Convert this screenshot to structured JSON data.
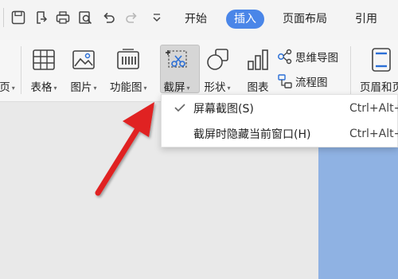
{
  "tabs": {
    "start": "开始",
    "insert": "插入",
    "layout": "页面布局",
    "reference": "引用"
  },
  "ribbon": {
    "cut_label": "页",
    "table_label": "表格",
    "picture_label": "图片",
    "function_label": "功能图",
    "screenshot_label": "截屏",
    "shape_label": "形状",
    "chart_label": "图表",
    "mindmap_label": "思维导图",
    "flowchart_label": "流程图",
    "header_footer_label": "页眉和页"
  },
  "dropdown": {
    "items": [
      {
        "label": "屏幕截图(S)",
        "shortcut": "Ctrl+Alt+",
        "checked": true
      },
      {
        "label": "截屏时隐藏当前窗口(H)",
        "shortcut": "Ctrl+Alt+",
        "checked": false
      }
    ]
  },
  "colors": {
    "accent": "#4a86e8",
    "arrow": "#e02020",
    "page": "#8fb2e3"
  },
  "icons": {
    "quick_access": [
      "save-icon",
      "export-icon",
      "print-icon",
      "print-preview-icon",
      "undo-icon",
      "redo-icon",
      "customize-icon"
    ],
    "ribbon": [
      "table-icon",
      "picture-icon",
      "function-chart-icon",
      "screenshot-icon",
      "shape-icon",
      "chart-icon",
      "mindmap-icon",
      "flowchart-icon",
      "header-footer-icon"
    ]
  }
}
